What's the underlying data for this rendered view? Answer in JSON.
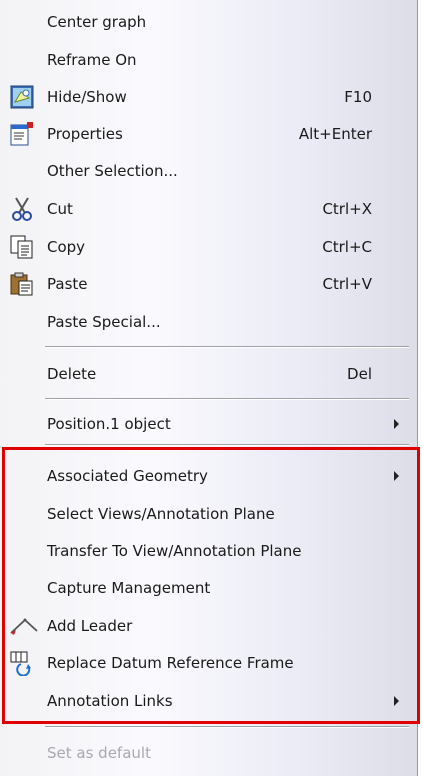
{
  "menu": {
    "items": [
      {
        "label": "Center graph",
        "shortcut": "",
        "submenu": false,
        "icon": ""
      },
      {
        "label": "Reframe On",
        "shortcut": "",
        "submenu": false,
        "icon": ""
      },
      {
        "label": "Hide/Show",
        "shortcut": "F10",
        "submenu": false,
        "icon": "hide-show-icon"
      },
      {
        "label": "Properties",
        "shortcut": "Alt+Enter",
        "submenu": false,
        "icon": "properties-icon"
      },
      {
        "label": "Other Selection...",
        "shortcut": "",
        "submenu": false,
        "icon": ""
      },
      {
        "label": "Cut",
        "shortcut": "Ctrl+X",
        "submenu": false,
        "icon": "scissors-icon"
      },
      {
        "label": "Copy",
        "shortcut": "Ctrl+C",
        "submenu": false,
        "icon": "copy-icon"
      },
      {
        "label": "Paste",
        "shortcut": "Ctrl+V",
        "submenu": false,
        "icon": "paste-icon"
      },
      {
        "label": "Paste Special...",
        "shortcut": "",
        "submenu": false,
        "icon": ""
      },
      {
        "label": "Delete",
        "shortcut": "Del",
        "submenu": false,
        "icon": ""
      },
      {
        "label": "Position.1 object",
        "shortcut": "",
        "submenu": true,
        "icon": ""
      },
      {
        "label": "Associated Geometry",
        "shortcut": "",
        "submenu": true,
        "icon": ""
      },
      {
        "label": "Select Views/Annotation Plane",
        "shortcut": "",
        "submenu": false,
        "icon": ""
      },
      {
        "label": "Transfer To View/Annotation Plane",
        "shortcut": "",
        "submenu": false,
        "icon": ""
      },
      {
        "label": "Capture Management",
        "shortcut": "",
        "submenu": false,
        "icon": ""
      },
      {
        "label": "Add Leader",
        "shortcut": "",
        "submenu": false,
        "icon": "add-leader-icon"
      },
      {
        "label": "Replace Datum Reference Frame",
        "shortcut": "",
        "submenu": false,
        "icon": "datum-reference-frame-icon"
      },
      {
        "label": "Annotation Links",
        "shortcut": "",
        "submenu": true,
        "icon": ""
      },
      {
        "label": "Set as default",
        "shortcut": "",
        "submenu": false,
        "icon": "",
        "disabled": true
      }
    ]
  },
  "colors": {
    "highlight_border": "#e00000",
    "disabled_text": "#a8a8b0"
  }
}
